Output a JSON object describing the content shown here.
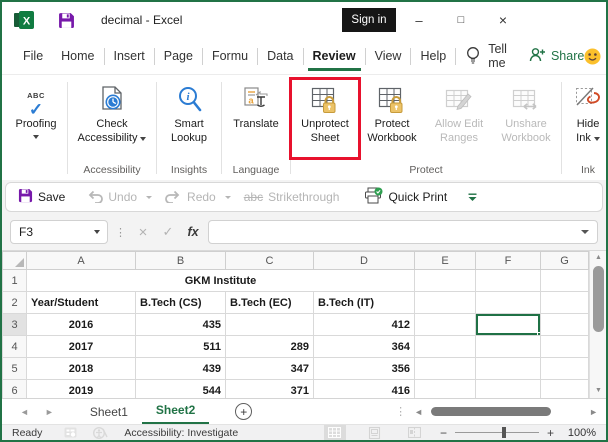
{
  "window": {
    "title": "decimal  -  Excel",
    "sign_in": "Sign in"
  },
  "icons": {
    "minimize": "–",
    "maximize": "□",
    "close": "×",
    "scroll_left": "◄",
    "scroll_right": "►",
    "scroll_up": "▲",
    "scroll_down": "▼",
    "add_sheet": "+",
    "dots": "⋮",
    "zoom_out": "−",
    "zoom_in": "+"
  },
  "tabs": {
    "items": [
      {
        "label": "File"
      },
      {
        "label": "Home"
      },
      {
        "label": "Insert"
      },
      {
        "label": "Page"
      },
      {
        "label": "Formu"
      },
      {
        "label": "Data"
      },
      {
        "label": "Review"
      },
      {
        "label": "View"
      },
      {
        "label": "Help"
      }
    ],
    "active": "Review",
    "tell_me": "Tell me",
    "share": "Share"
  },
  "ribbon": {
    "groups": [
      {
        "label": "",
        "buttons": [
          {
            "line1": "Proofing",
            "line2": ""
          }
        ]
      },
      {
        "label": "Accessibility",
        "buttons": [
          {
            "line1": "Check",
            "line2": "Accessibility"
          }
        ]
      },
      {
        "label": "Insights",
        "buttons": [
          {
            "line1": "Smart",
            "line2": "Lookup"
          }
        ]
      },
      {
        "label": "Language",
        "buttons": [
          {
            "line1": "Translate",
            "line2": ""
          }
        ]
      },
      {
        "label": "Protect",
        "buttons": [
          {
            "line1": "Unprotect",
            "line2": "Sheet",
            "highlighted": true
          },
          {
            "line1": "Protect",
            "line2": "Workbook"
          },
          {
            "line1": "Allow Edit",
            "line2": "Ranges",
            "disabled": true
          },
          {
            "line1": "Unshare",
            "line2": "Workbook",
            "disabled": true
          }
        ]
      },
      {
        "label": "Ink",
        "buttons": [
          {
            "line1": "Hide",
            "line2": "Ink"
          }
        ]
      }
    ]
  },
  "qat": {
    "save": "Save",
    "undo": "Undo",
    "redo": "Redo",
    "strike_abc": "abc",
    "strikethrough": "Strikethrough",
    "quick_print": "Quick Print"
  },
  "formula": {
    "name_box": "F3",
    "cancel_icon": "×",
    "enter_icon": "✓",
    "fx_label": "fx",
    "value": ""
  },
  "grid": {
    "columns": [
      "A",
      "B",
      "C",
      "D",
      "E",
      "F",
      "G"
    ],
    "selected": {
      "cell": "F3",
      "column": "F",
      "row": "3"
    },
    "title_row": {
      "n": "1",
      "text": "GKM Institute"
    },
    "header_row": {
      "n": "2",
      "cells": [
        "Year/Student",
        "B.Tech (CS)",
        "B.Tech (EC)",
        "B.Tech (IT)"
      ]
    },
    "data_rows": [
      {
        "n": "3",
        "year": "2016",
        "cs": "435",
        "ec": "",
        "it": "412"
      },
      {
        "n": "4",
        "year": "2017",
        "cs": "511",
        "ec": "289",
        "it": "364"
      },
      {
        "n": "5",
        "year": "2018",
        "cs": "439",
        "ec": "347",
        "it": "356"
      },
      {
        "n": "6",
        "year": "2019",
        "cs": "544",
        "ec": "371",
        "it": "416"
      }
    ]
  },
  "sheet_tabs": {
    "items": [
      {
        "label": "Sheet1"
      },
      {
        "label": "Sheet2"
      }
    ],
    "active": "Sheet2"
  },
  "status": {
    "mode": "Ready",
    "accessibility": "Accessibility: Investigate",
    "zoom_level": "100%"
  },
  "colors": {
    "excel_green": "#217346",
    "selection_green": "#107c41",
    "highlight_red": "#e8112d",
    "save_purple": "#7719aa",
    "insights_blue": "#2b7cd3",
    "lock_gold": "#e6c068",
    "disabled_gray": "#b8b8b8"
  }
}
